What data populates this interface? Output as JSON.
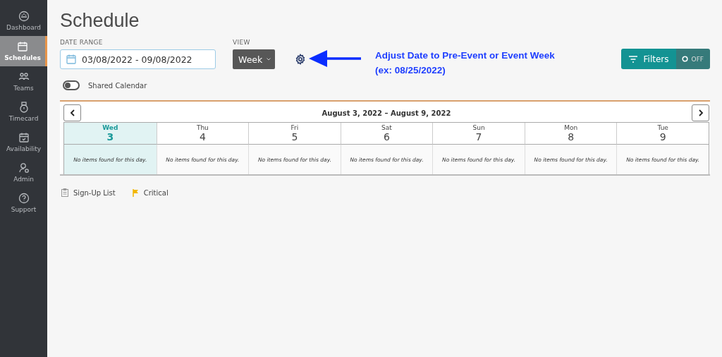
{
  "sidebar": {
    "items": [
      {
        "label": "Dashboard",
        "selected": false
      },
      {
        "label": "Schedules",
        "selected": true
      },
      {
        "label": "Teams",
        "selected": false
      },
      {
        "label": "Timecard",
        "selected": false
      },
      {
        "label": "Availability",
        "selected": false
      },
      {
        "label": "Admin",
        "selected": false
      },
      {
        "label": "Support",
        "selected": false
      }
    ]
  },
  "title": "Schedule",
  "date_range": {
    "label": "DATE RANGE",
    "value": "03/08/2022 - 09/08/2022"
  },
  "view": {
    "label": "VIEW",
    "value": "Week"
  },
  "annotation": [
    "Adjust Date to Pre-Event or Event Week",
    "(ex: 08/25/2022)"
  ],
  "filters": {
    "label": "Filters",
    "state": "OFF",
    "on": false
  },
  "shared_calendar": {
    "label": "Shared Calendar",
    "on": false
  },
  "calendar": {
    "range": "August 3, 2022 – August 9, 2022",
    "days": [
      {
        "weekday": "Wed",
        "date": "3",
        "selected": true,
        "message": "No items found for this day."
      },
      {
        "weekday": "Thu",
        "date": "4",
        "selected": false,
        "message": "No items found for this day."
      },
      {
        "weekday": "Fri",
        "date": "5",
        "selected": false,
        "message": "No items found for this day."
      },
      {
        "weekday": "Sat",
        "date": "6",
        "selected": false,
        "message": "No items found for this day."
      },
      {
        "weekday": "Sun",
        "date": "7",
        "selected": false,
        "message": "No items found for this day."
      },
      {
        "weekday": "Mon",
        "date": "8",
        "selected": false,
        "message": "No items found for this day."
      },
      {
        "weekday": "Tue",
        "date": "9",
        "selected": false,
        "message": "No items found for this day."
      }
    ]
  },
  "legend": [
    {
      "kind": "signup",
      "label": "Sign-Up List"
    },
    {
      "kind": "critical",
      "label": "Critical"
    }
  ]
}
